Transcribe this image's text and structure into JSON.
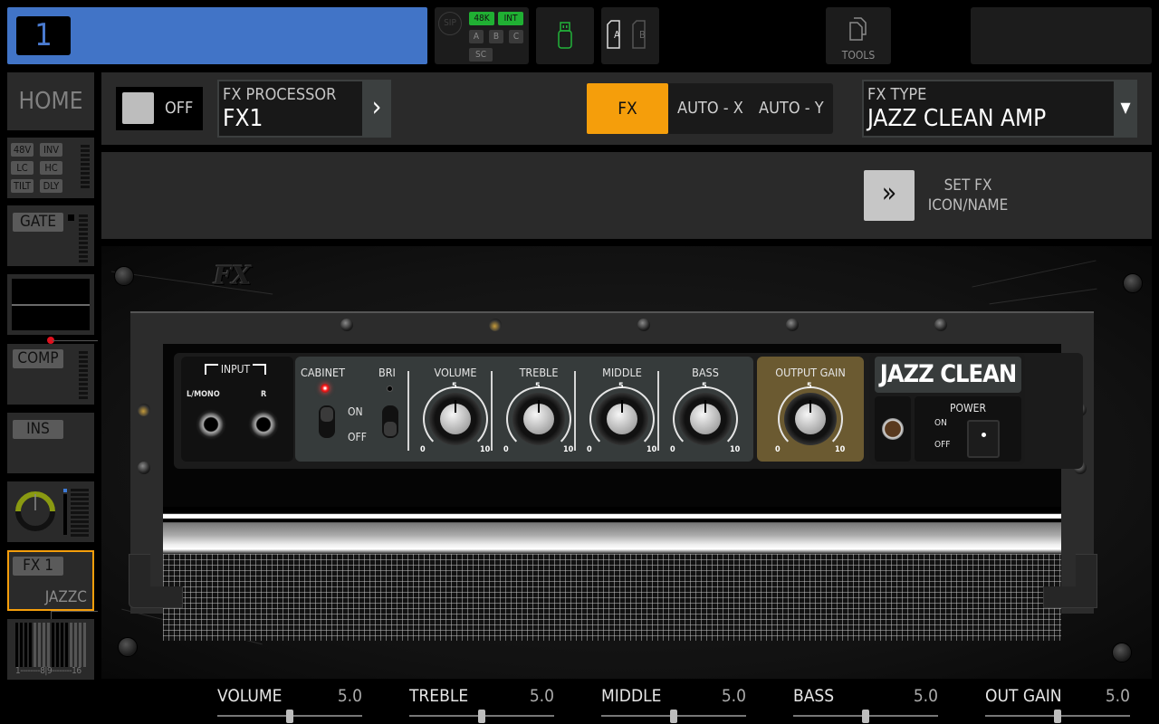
{
  "topbar": {
    "channel_number": "1",
    "channel_color": "#4174c7",
    "status": {
      "sip": "SIP",
      "rate": "48K",
      "clock": "INT",
      "buses": [
        "A",
        "B",
        "C"
      ],
      "sc": "SC"
    },
    "usb_icon": "usb-stick-icon",
    "cards": [
      "A",
      "B"
    ],
    "tools_label": "TOOLS"
  },
  "sidebar": {
    "home_label": "HOME",
    "preamp_tags": [
      "48V",
      "INV",
      "LC",
      "HC",
      "TILT",
      "DLY"
    ],
    "gate_label": "GATE",
    "comp_label": "COMP",
    "ins_label": "INS",
    "fx_label": "FX 1",
    "fx_sub": "JAZZC",
    "bus_scale": "1--------8|9--------16",
    "selected_color": "#f59e0b"
  },
  "header": {
    "power_state": "OFF",
    "processor_label": "FX PROCESSOR",
    "processor_value": "FX1",
    "modes": [
      "FX",
      "AUTO - X",
      "AUTO - Y"
    ],
    "active_mode": "FX",
    "fx_type_label": "FX TYPE",
    "fx_type_value": "JAZZ CLEAN AMP",
    "set_fx_label_1": "SET FX",
    "set_fx_label_2": "ICON/NAME"
  },
  "amp": {
    "logo": "FX",
    "input_label": "INPUT",
    "input_left": "L/MONO",
    "input_right": "R",
    "cabinet_label": "CABINET",
    "bri_label": "BRI",
    "on_label": "ON",
    "off_label": "OFF",
    "knobs": [
      {
        "label": "VOLUME",
        "value": 5,
        "min": "0",
        "mid": "5",
        "max": "10"
      },
      {
        "label": "TREBLE",
        "value": 5,
        "min": "0",
        "mid": "5",
        "max": "10"
      },
      {
        "label": "MIDDLE",
        "value": 5,
        "min": "0",
        "mid": "5",
        "max": "10"
      },
      {
        "label": "BASS",
        "value": 5,
        "min": "0",
        "mid": "5",
        "max": "10"
      },
      {
        "label": "OUTPUT GAIN",
        "value": 5,
        "min": "0",
        "mid": "5",
        "max": "10"
      }
    ],
    "brand": "JAZZ CLEAN",
    "power_label": "POWER",
    "power_on": "ON",
    "power_off": "OFF"
  },
  "sliders": [
    {
      "name": "VOLUME",
      "value": "5.0",
      "fraction": 0.5
    },
    {
      "name": "TREBLE",
      "value": "5.0",
      "fraction": 0.5
    },
    {
      "name": "MIDDLE",
      "value": "5.0",
      "fraction": 0.5
    },
    {
      "name": "BASS",
      "value": "5.0",
      "fraction": 0.5
    },
    {
      "name": "OUT GAIN",
      "value": "5.0",
      "fraction": 0.5
    }
  ]
}
